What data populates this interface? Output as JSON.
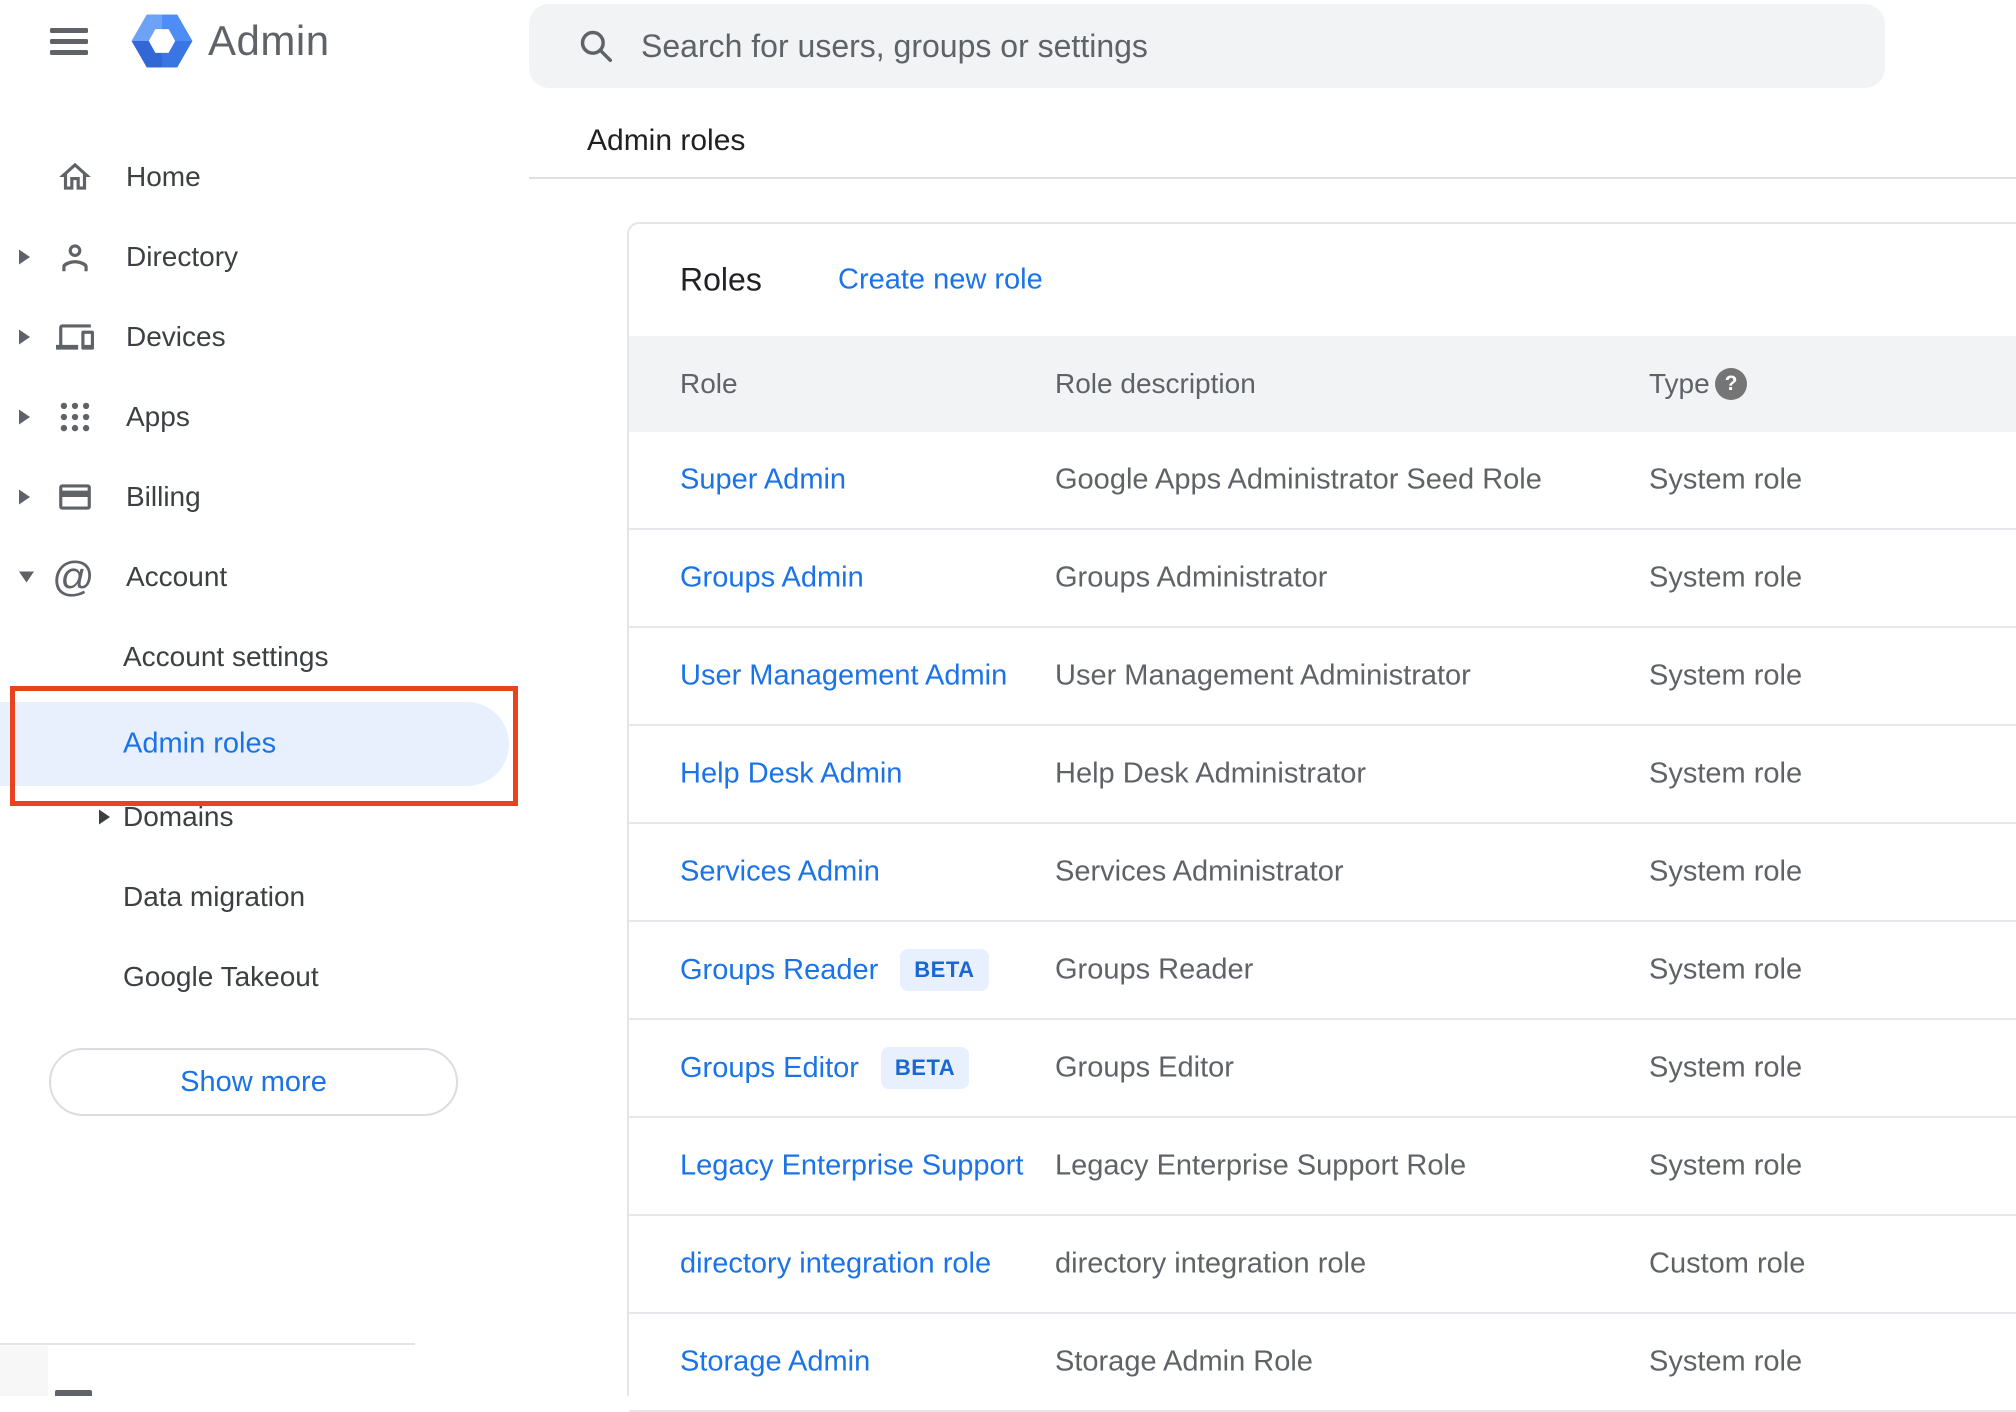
{
  "brand": {
    "app_name": "Admin"
  },
  "sidebar": {
    "items": [
      {
        "label": "Home",
        "icon": "home-icon",
        "chevron": "none"
      },
      {
        "label": "Directory",
        "icon": "person-icon",
        "chevron": "right"
      },
      {
        "label": "Devices",
        "icon": "devices-icon",
        "chevron": "right"
      },
      {
        "label": "Apps",
        "icon": "apps-grid-icon",
        "chevron": "right"
      },
      {
        "label": "Billing",
        "icon": "credit-card-icon",
        "chevron": "right"
      },
      {
        "label": "Account",
        "icon": "at-sign-icon",
        "chevron": "down"
      }
    ],
    "sub_items": [
      {
        "label": "Account settings",
        "selected": false
      },
      {
        "label": "Admin roles",
        "selected": true,
        "annotated": true
      },
      {
        "label": "Domains",
        "selected": false,
        "chevron": "right"
      },
      {
        "label": "Data migration",
        "selected": false
      },
      {
        "label": "Google Takeout",
        "selected": false
      }
    ],
    "show_more_label": "Show more"
  },
  "search": {
    "placeholder": "Search for users, groups or settings"
  },
  "breadcrumb": "Admin roles",
  "panel": {
    "title": "Roles",
    "create_link": "Create new role",
    "columns": {
      "role": "Role",
      "description": "Role description",
      "type": "Type"
    },
    "rows": [
      {
        "role": "Super Admin",
        "beta": false,
        "description": "Google Apps Administrator Seed Role",
        "type": "System role"
      },
      {
        "role": "Groups Admin",
        "beta": false,
        "description": "Groups Administrator",
        "type": "System role"
      },
      {
        "role": "User Management Admin",
        "beta": false,
        "description": "User Management Administrator",
        "type": "System role"
      },
      {
        "role": "Help Desk Admin",
        "beta": false,
        "description": "Help Desk Administrator",
        "type": "System role"
      },
      {
        "role": "Services Admin",
        "beta": false,
        "description": "Services Administrator",
        "type": "System role"
      },
      {
        "role": "Groups Reader",
        "beta": true,
        "beta_label": "BETA",
        "description": "Groups Reader",
        "type": "System role"
      },
      {
        "role": "Groups Editor",
        "beta": true,
        "beta_label": "BETA",
        "description": "Groups Editor",
        "type": "System role"
      },
      {
        "role": "Legacy Enterprise Support",
        "beta": false,
        "description": "Legacy Enterprise Support Role",
        "type": "System role"
      },
      {
        "role": "directory integration role",
        "beta": false,
        "description": "directory integration role",
        "type": "Custom role"
      },
      {
        "role": "Storage Admin",
        "beta": false,
        "description": "Storage Admin Role",
        "type": "System role"
      }
    ]
  },
  "colors": {
    "accent_blue": "#1a73e8",
    "selected_item_bg": "#e8f0fe",
    "annotation_red": "#e8431f",
    "beta_badge_bg": "#e8f0fe",
    "beta_badge_text": "#1967d2",
    "table_header_bg": "#f1f3f4",
    "search_bar_bg": "#f1f3f4"
  }
}
